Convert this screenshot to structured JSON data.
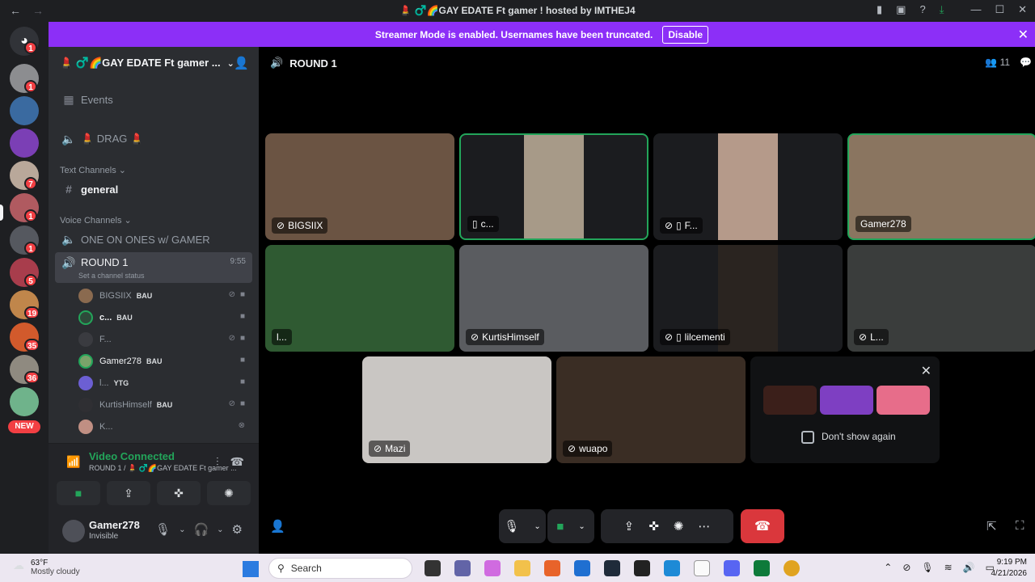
{
  "window": {
    "title": "💄 ♂️🌈GAY EDATE Ft gamer ! hosted by IMTHEJ4",
    "back": "←",
    "forward": "→"
  },
  "banner": {
    "text": "Streamer Mode is enabled. Usernames have been truncated.",
    "button": "Disable"
  },
  "rail": {
    "badges": [
      "1",
      "1",
      "7",
      "1",
      "1",
      "5",
      "19",
      "35",
      "36"
    ],
    "new_label": "NEW"
  },
  "server": {
    "name": "💄 ♂️🌈GAY EDATE Ft gamer ..."
  },
  "sidebar": {
    "events": "Events",
    "drag": "💄 DRAG 💄",
    "text_category": "Text Channels",
    "general": "general",
    "voice_category": "Voice Channels",
    "one_on_ones": "ONE ON ONES w/ GAMER",
    "round": "ROUND 1",
    "round_time": "9:55",
    "round_status": "Set a channel status",
    "members": [
      {
        "name": "BIGSIIX",
        "tag": "BAU",
        "color": "#8a6a4f"
      },
      {
        "name": "c...",
        "tag": "BAU",
        "color": "#2e4a3a"
      },
      {
        "name": "F...",
        "tag": "",
        "color": "#3a3b40"
      },
      {
        "name": "Gamer278",
        "tag": "BAU",
        "color": "#7aa36a"
      },
      {
        "name": "l...",
        "tag": "YTG",
        "color": "#6c5fd3"
      },
      {
        "name": "KurtisHimself",
        "tag": "BAU",
        "color": "#2f2f33"
      },
      {
        "name": "K...",
        "tag": "",
        "color": "#c08f83"
      }
    ]
  },
  "voice_panel": {
    "title": "Video Connected",
    "subtitle": "ROUND 1 / 💄 ♂️🌈GAY EDATE Ft gamer ..."
  },
  "user": {
    "name": "Gamer278",
    "status": "Invisible"
  },
  "stage": {
    "channel": "ROUND 1",
    "participant_count": "11",
    "tiles": [
      {
        "name": "BIGSIIX",
        "icon": "muted",
        "color": "#6b5443",
        "speaking": false
      },
      {
        "name": "c...",
        "icon": "phone",
        "color": "#1b1c1f",
        "speaking": true
      },
      {
        "name": "F...",
        "icon": "muted-phone",
        "color": "#1b1c1f",
        "speaking": false
      },
      {
        "name": "Gamer278",
        "icon": "",
        "color": "#8a7560",
        "speaking": true
      },
      {
        "name": "l...",
        "icon": "",
        "color": "#2f5a32",
        "speaking": false
      },
      {
        "name": "KurtisHimself",
        "icon": "muted",
        "color": "#5a5c60",
        "speaking": false
      },
      {
        "name": "lilcementi",
        "icon": "muted-phone",
        "color": "#1b1c1f",
        "speaking": false
      },
      {
        "name": "L...",
        "icon": "muted",
        "color": "#3a3d3c",
        "speaking": false
      },
      {
        "name": "Mazi",
        "icon": "muted",
        "color": "#c9c6c3",
        "speaking": false
      },
      {
        "name": "wuapo",
        "icon": "deafened",
        "color": "#3a2d24",
        "speaking": false
      }
    ],
    "promo": {
      "dont_show": "Don't show again"
    }
  },
  "taskbar": {
    "temp": "63°F",
    "weather": "Mostly cloudy",
    "search": "Search",
    "time": "9:19 PM",
    "date": "4/21/2026"
  }
}
